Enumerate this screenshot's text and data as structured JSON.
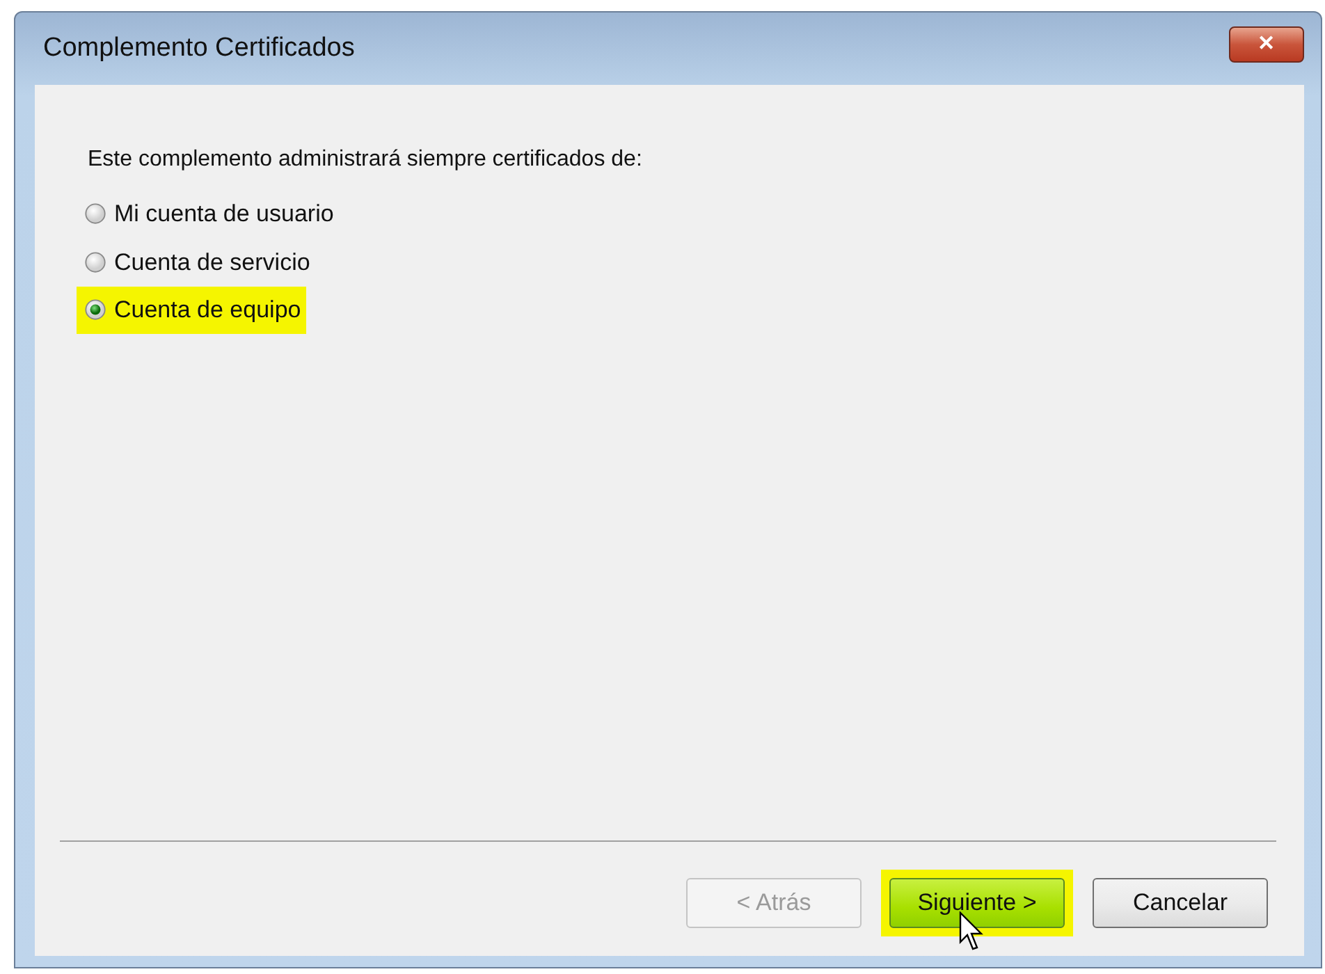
{
  "window": {
    "title": "Complemento Certificados",
    "close": "✕"
  },
  "prompt": "Este complemento administrará siempre certificados de:",
  "options": [
    {
      "label": "Mi cuenta de usuario",
      "selected": false,
      "highlighted": false
    },
    {
      "label": "Cuenta de servicio",
      "selected": false,
      "highlighted": false
    },
    {
      "label": "Cuenta de equipo",
      "selected": true,
      "highlighted": true
    }
  ],
  "buttons": [
    {
      "label": "< Atrás",
      "disabled": true,
      "highlighted": false,
      "hovered": false
    },
    {
      "label": "Siguiente >",
      "disabled": false,
      "highlighted": true,
      "hovered": true
    },
    {
      "label": "Cancelar",
      "disabled": false,
      "highlighted": false,
      "hovered": false
    }
  ]
}
